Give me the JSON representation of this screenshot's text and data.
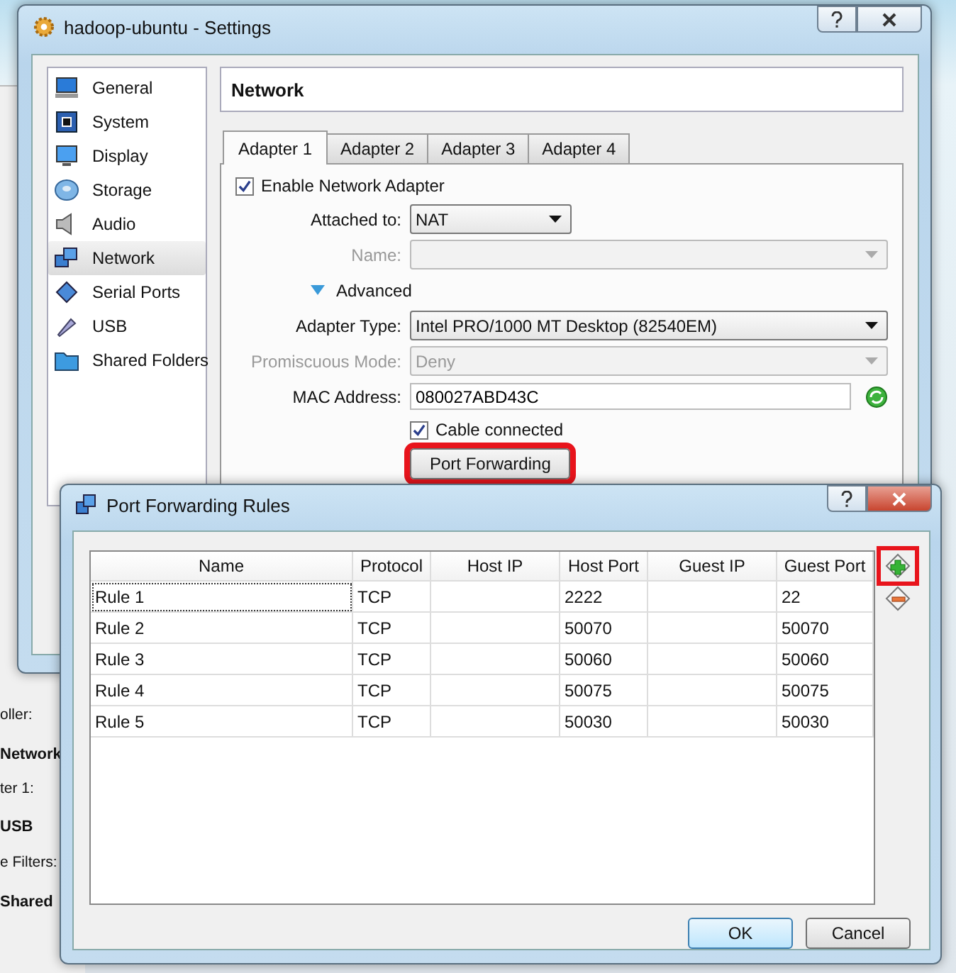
{
  "background_window": {
    "labels": [
      {
        "kind": "field",
        "text": "oller:"
      },
      {
        "kind": "heading",
        "text": "Network"
      },
      {
        "kind": "field",
        "text": "ter 1:"
      },
      {
        "kind": "heading",
        "text": "USB"
      },
      {
        "kind": "field",
        "text": "e Filters:"
      },
      {
        "kind": "heading",
        "text": "Shared"
      }
    ]
  },
  "settings_window": {
    "title": "hadoop-ubuntu - Settings",
    "sidebar": {
      "items": [
        {
          "label": "General",
          "selected": false
        },
        {
          "label": "System",
          "selected": false
        },
        {
          "label": "Display",
          "selected": false
        },
        {
          "label": "Storage",
          "selected": false
        },
        {
          "label": "Audio",
          "selected": false
        },
        {
          "label": "Network",
          "selected": true
        },
        {
          "label": "Serial Ports",
          "selected": false
        },
        {
          "label": "USB",
          "selected": false
        },
        {
          "label": "Shared Folders",
          "selected": false
        }
      ]
    },
    "section_title": "Network",
    "tabs": [
      {
        "label": "Adapter 1",
        "selected": true
      },
      {
        "label": "Adapter 2",
        "selected": false
      },
      {
        "label": "Adapter 3",
        "selected": false
      },
      {
        "label": "Adapter 4",
        "selected": false
      }
    ],
    "enable_adapter": {
      "label": "Enable Network Adapter",
      "checked": true
    },
    "fields": [
      {
        "kind": "select-short",
        "label": "Attached to:",
        "value": "NAT",
        "disabled": false
      },
      {
        "kind": "select",
        "label": "Name:",
        "disabled": true
      },
      {
        "kind": "expander",
        "label": "Advanced",
        "expanded": true
      },
      {
        "kind": "select",
        "label": "Adapter Type:",
        "value": "Intel PRO/1000 MT Desktop (82540EM)",
        "disabled": false
      },
      {
        "kind": "select",
        "label": "Promiscuous Mode:",
        "value": "Deny",
        "disabled": true
      },
      {
        "kind": "text",
        "label": "MAC Address:",
        "value": "080027ABD43C",
        "disabled": false
      }
    ],
    "cable_connected": {
      "label": "Cable connected",
      "checked": true
    },
    "port_forwarding_button": {
      "label": "Port Forwarding",
      "highlighted": true
    }
  },
  "port_forwarding_dialog": {
    "title": "Port Forwarding Rules",
    "table": {
      "columns": [
        "Name",
        "Protocol",
        "Host IP",
        "Host Port",
        "Guest IP",
        "Guest Port"
      ],
      "rows": [
        {
          "cells": [
            "Rule 1",
            "TCP",
            "",
            "2222",
            "",
            "22"
          ],
          "focused": true
        },
        {
          "cells": [
            "Rule 2",
            "TCP",
            "",
            "50070",
            "",
            "50070"
          ],
          "focused": false
        },
        {
          "cells": [
            "Rule 3",
            "TCP",
            "",
            "50060",
            "",
            "50060"
          ],
          "focused": false
        },
        {
          "cells": [
            "Rule 4",
            "TCP",
            "",
            "50075",
            "",
            "50075"
          ],
          "focused": false
        },
        {
          "cells": [
            "Rule 5",
            "TCP",
            "",
            "50030",
            "",
            "50030"
          ],
          "focused": false
        }
      ]
    },
    "add_rule": {
      "highlighted": true
    },
    "buttons": [
      {
        "label": "OK",
        "default": true
      },
      {
        "label": "Cancel",
        "default": false
      }
    ]
  }
}
